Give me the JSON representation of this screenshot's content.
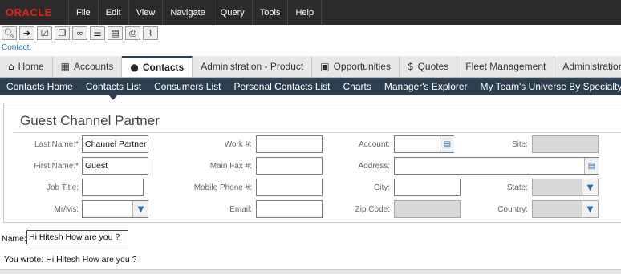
{
  "app": {
    "logo_text": "ORACLE",
    "logo_color": "#e8201b"
  },
  "menu": [
    "File",
    "Edit",
    "View",
    "Navigate",
    "Query",
    "Tools",
    "Help"
  ],
  "toolbar": {
    "buttons": [
      "search-icon",
      "go-icon",
      "checklist-icon",
      "copy-icon",
      "link-icon",
      "list-icon",
      "clipboard-icon",
      "print-icon",
      "chart-icon"
    ]
  },
  "breadcrumb": "Contact:",
  "screen_tabs": [
    {
      "label": "Home",
      "icon": "home-icon"
    },
    {
      "label": "Accounts",
      "icon": "building-icon"
    },
    {
      "label": "Contacts",
      "icon": "person-icon"
    },
    {
      "label": "Administration - Product",
      "icon": ""
    },
    {
      "label": "Opportunities",
      "icon": "briefcase-icon"
    },
    {
      "label": "Quotes",
      "icon": "dollar-icon"
    },
    {
      "label": "Fleet Management",
      "icon": ""
    },
    {
      "label": "Administration",
      "icon": ""
    }
  ],
  "sub_tabs": [
    "Contacts Home",
    "Contacts List",
    "Consumers List",
    "Personal Contacts List",
    "Charts",
    "Manager's Explorer",
    "My Team's Universe By Specialty"
  ],
  "form": {
    "title": "Guest Channel Partner",
    "last_name_label": "Last Name:",
    "last_name_value": "Channel Partner",
    "first_name_label": "First Name:",
    "first_name_value": "Guest",
    "required_marker": "*",
    "job_title_label": "Job Title:",
    "job_title_value": "",
    "mr_ms_label": "Mr/Ms:",
    "mr_ms_value": "",
    "work_phone_label": "Work #:",
    "work_phone_value": "",
    "main_fax_label": "Main Fax #:",
    "main_fax_value": "",
    "mobile_phone_label": "Mobile Phone #:",
    "mobile_phone_value": "",
    "email_label": "Email:",
    "email_value": "",
    "account_label": "Account:",
    "account_value": "",
    "address_label": "Address:",
    "address_value": "",
    "city_label": "City:",
    "city_value": "",
    "zip_label": "Zip Code:",
    "zip_value": "",
    "site_label": "Site:",
    "site_value": "",
    "state_label": "State:",
    "state_value": "",
    "country_label": "Country:",
    "country_value": ""
  },
  "custom": {
    "name_label": "Name:",
    "name_value": "Hi Hitesh How are you ?",
    "wrote_label": "You wrote:",
    "wrote_value": "Hi Hitesh How are you ?"
  }
}
